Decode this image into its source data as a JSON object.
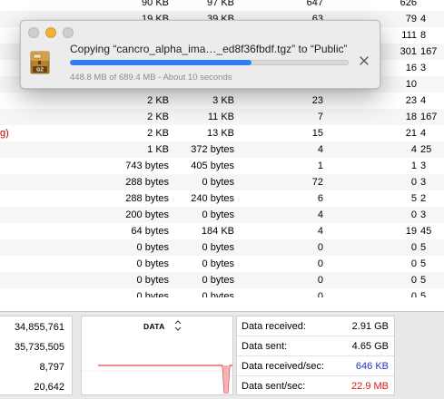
{
  "colors": {
    "accent_blue": "#2f7ff0",
    "received_blue": "#1f35c8",
    "sent_red": "#e0141a",
    "graph_red": "#e0141a"
  },
  "table": {
    "rows": [
      {
        "c0": "",
        "c1": "90 KB",
        "c2": "97 KB",
        "c3": "647",
        "c4": "626",
        "c5": ""
      },
      {
        "c0": "",
        "c1": "19 KB",
        "c2": "39 KB",
        "c3": "63",
        "c4": "79",
        "c5": "4"
      },
      {
        "c0": "",
        "c1": "",
        "c2": "",
        "c3": "",
        "c4": "111",
        "c5": "8"
      },
      {
        "c0": "",
        "c1": "",
        "c2": "",
        "c3": "",
        "c4": "301",
        "c5": "167"
      },
      {
        "c0": "",
        "c1": "",
        "c2": "",
        "c3": "",
        "c4": "16",
        "c5": "3"
      },
      {
        "c0": "",
        "c1": "",
        "c2": "",
        "c3": "",
        "c4": "10",
        "c5": ""
      },
      {
        "c0": "",
        "c1": "2 KB",
        "c2": "3 KB",
        "c3": "23",
        "c4": "23",
        "c5": "4"
      },
      {
        "c0": "",
        "c1": "2 KB",
        "c2": "11 KB",
        "c3": "7",
        "c4": "18",
        "c5": "167"
      },
      {
        "c0": "g)",
        "c1": "2 KB",
        "c2": "13 KB",
        "c3": "15",
        "c4": "21",
        "c5": "4"
      },
      {
        "c0": "",
        "c1": "1 KB",
        "c2": "372 bytes",
        "c3": "4",
        "c4": "4",
        "c5": "25"
      },
      {
        "c0": "",
        "c1": "743 bytes",
        "c2": "405 bytes",
        "c3": "1",
        "c4": "1",
        "c5": "3"
      },
      {
        "c0": "",
        "c1": "288 bytes",
        "c2": "0 bytes",
        "c3": "72",
        "c4": "0",
        "c5": "3"
      },
      {
        "c0": "",
        "c1": "288 bytes",
        "c2": "240 bytes",
        "c3": "6",
        "c4": "5",
        "c5": "2"
      },
      {
        "c0": "",
        "c1": "200 bytes",
        "c2": "0 bytes",
        "c3": "4",
        "c4": "0",
        "c5": "3"
      },
      {
        "c0": "",
        "c1": "64 bytes",
        "c2": "184 KB",
        "c3": "4",
        "c4": "19",
        "c5": "45"
      },
      {
        "c0": "",
        "c1": "0 bytes",
        "c2": "0 bytes",
        "c3": "0",
        "c4": "0",
        "c5": "5"
      },
      {
        "c0": "",
        "c1": "0 bytes",
        "c2": "0 bytes",
        "c3": "0",
        "c4": "0",
        "c5": "5"
      },
      {
        "c0": "",
        "c1": "0 bytes",
        "c2": "0 bytes",
        "c3": "0",
        "c4": "0",
        "c5": "5"
      },
      {
        "c0": "",
        "c1": "0 bytes",
        "c2": "0 bytes",
        "c3": "0",
        "c4": "0",
        "c5": "5"
      }
    ]
  },
  "copy_dialog": {
    "title": "Copying “cancro_alpha_ima…_ed8f36fbdf.tgz” to “Public”",
    "status": "448.8 MB of 689.4 MB - About 10 seconds",
    "progress": 0.651,
    "icon": "tgz-archive-icon",
    "icon_label": "GZ",
    "cancel_icon": "close-icon"
  },
  "bottom": {
    "left_values": [
      "34,855,761",
      "35,735,505",
      "8,797",
      "20,642"
    ],
    "graph": {
      "title": "DATA",
      "selector_icon": "up-down-chevron-icon"
    },
    "stats": [
      {
        "label": "Data received:",
        "value": "2.91 GB",
        "color": "#000000"
      },
      {
        "label": "Data sent:",
        "value": "4.65 GB",
        "color": "#000000"
      },
      {
        "label": "Data received/sec:",
        "value": "646 KB",
        "color": "#1f35c8"
      },
      {
        "label": "Data sent/sec:",
        "value": "22.9 MB",
        "color": "#e0141a"
      }
    ]
  }
}
